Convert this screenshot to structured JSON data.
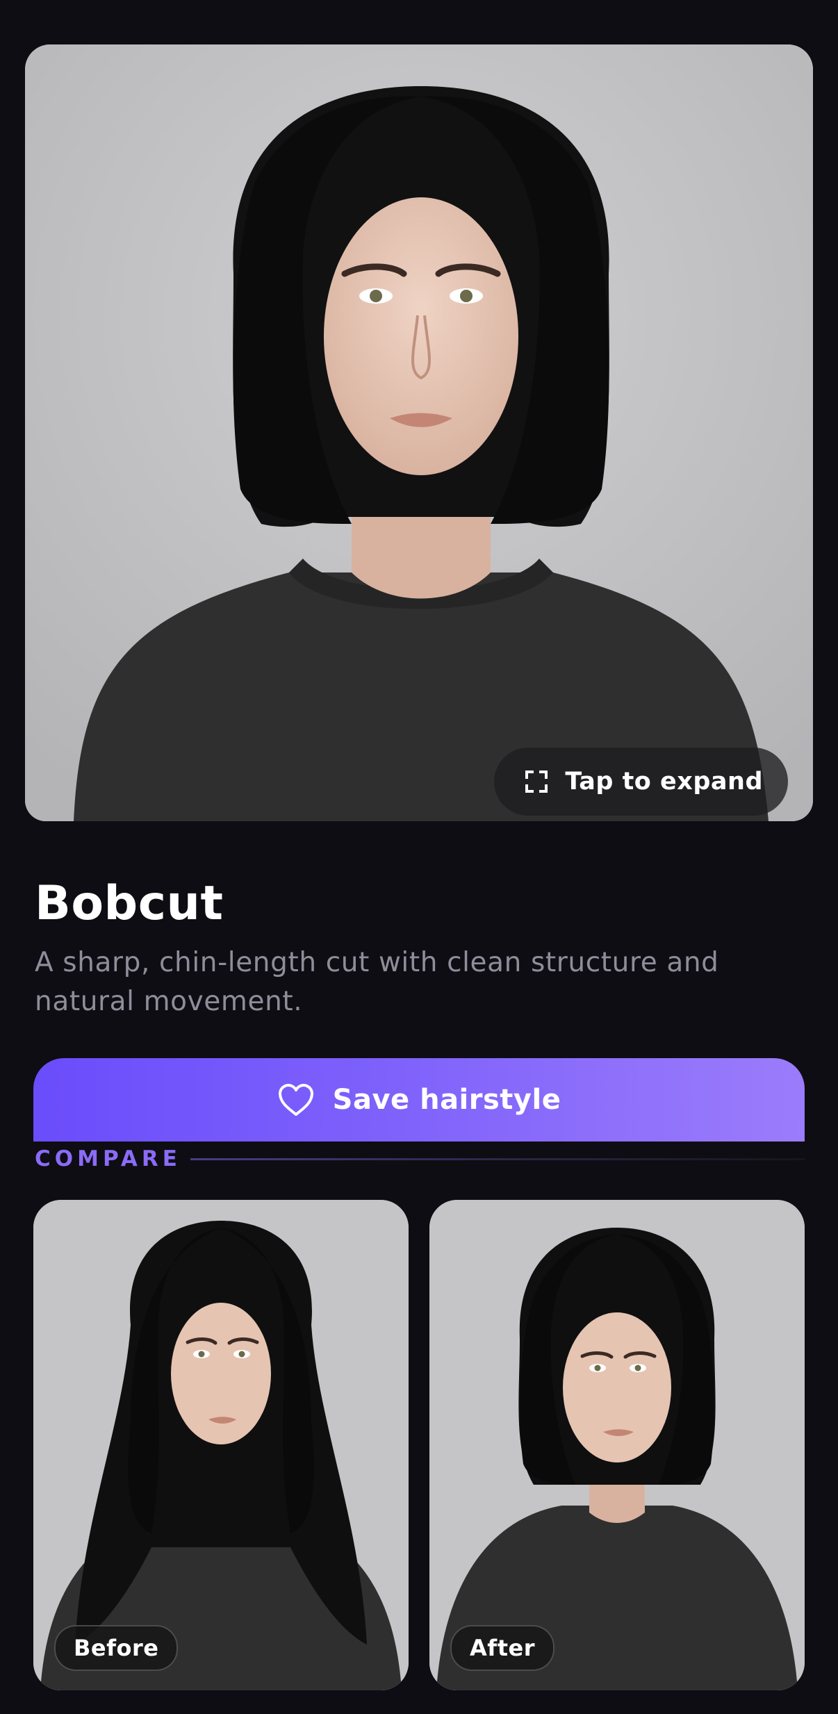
{
  "hero": {
    "expand_label": "Tap to expand"
  },
  "style": {
    "title": "Bobcut",
    "description": "A sharp, chin-length cut with clean structure and natural movement."
  },
  "actions": {
    "save_label": "Save hairstyle"
  },
  "compare": {
    "label": "COMPARE",
    "before_label": "Before",
    "after_label": "After"
  },
  "colors": {
    "background": "#0e0d13",
    "accent": "#7e61fb",
    "accent_text": "#8b6bf7",
    "muted_text": "#8f8d9a"
  },
  "icons": {
    "expand": "expand-corners-icon",
    "save": "heart-outline-icon"
  }
}
